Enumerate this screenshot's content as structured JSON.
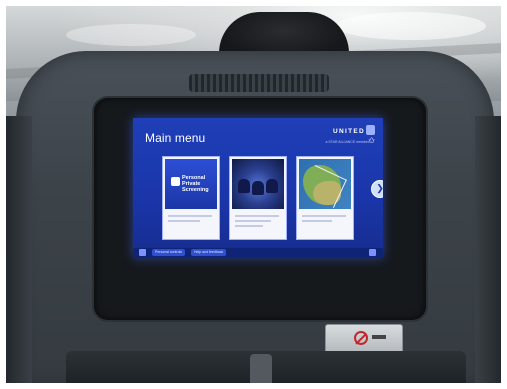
{
  "screen": {
    "title": "Main menu",
    "brand": "UNITED",
    "brand_sub": "a STAR ALLIANCE member",
    "card1_label": "Personal\nPrivate\nScreening",
    "bottom_buttons": [
      "Personal controls",
      "Help and feedback"
    ],
    "pager_dots": 4,
    "active_dot": 1
  },
  "colors": {
    "screen_blue": "#1f3fb8",
    "seat_gray": "#3c4349"
  }
}
